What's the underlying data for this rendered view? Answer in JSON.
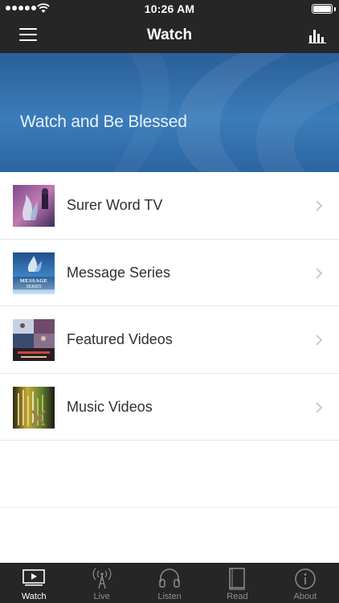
{
  "status_bar": {
    "time": "10:26 AM"
  },
  "nav": {
    "title": "Watch"
  },
  "hero": {
    "tagline": "Watch and Be Blessed"
  },
  "list": [
    {
      "label": "Surer Word TV",
      "thumb": "surer-word-tv-thumb"
    },
    {
      "label": "Message Series",
      "thumb": "message-series-thumb",
      "thumb_text": "MESSAGE SERIES"
    },
    {
      "label": "Featured Videos",
      "thumb": "featured-videos-thumb"
    },
    {
      "label": "Music Videos",
      "thumb": "music-videos-thumb"
    }
  ],
  "tabbar": {
    "items": [
      {
        "label": "Watch",
        "icon": "play-screen-icon",
        "active": true
      },
      {
        "label": "Live",
        "icon": "broadcast-tower-icon",
        "active": false
      },
      {
        "label": "Listen",
        "icon": "headphones-icon",
        "active": false
      },
      {
        "label": "Read",
        "icon": "book-icon",
        "active": false
      },
      {
        "label": "About",
        "icon": "info-icon",
        "active": false
      }
    ]
  },
  "colors": {
    "bar_background": "#262626",
    "hero_blue": "#3a7bb8",
    "text": "#303030",
    "inactive_tab": "#8d8d8d"
  }
}
